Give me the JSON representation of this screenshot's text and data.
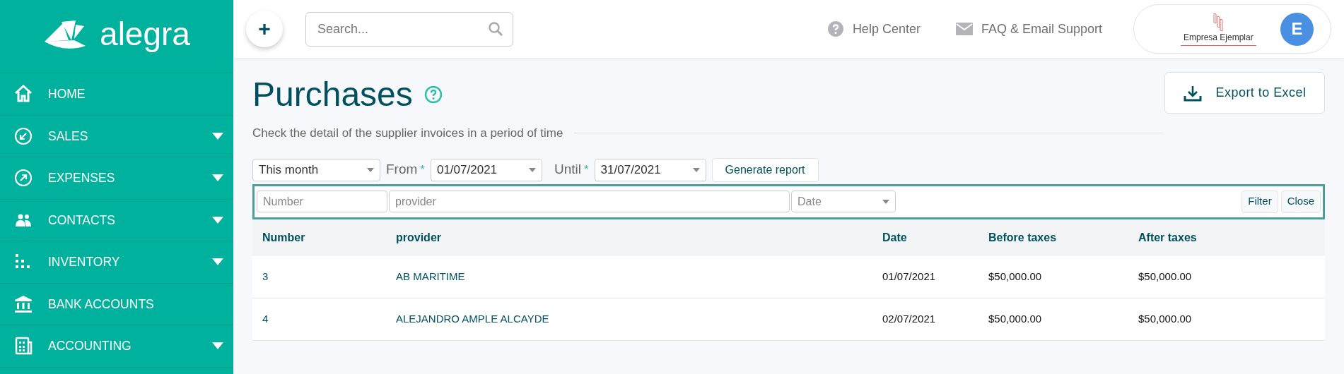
{
  "sidebar": {
    "logo": "alegra",
    "items": [
      {
        "label": "HOME",
        "kind": "home",
        "expandable": false
      },
      {
        "label": "SALES",
        "kind": "sales",
        "expandable": true
      },
      {
        "label": "EXPENSES",
        "kind": "expenses",
        "expandable": true
      },
      {
        "label": "CONTACTS",
        "kind": "contacts",
        "expandable": true
      },
      {
        "label": "INVENTORY",
        "kind": "inventory",
        "expandable": true
      },
      {
        "label": "BANK ACCOUNTS",
        "kind": "bank",
        "expandable": false
      },
      {
        "label": "ACCOUNTING",
        "kind": "accounting",
        "expandable": true
      }
    ]
  },
  "topbar": {
    "add_button": "+",
    "search": {
      "placeholder": "Search..."
    },
    "links": [
      {
        "label": "Help Center",
        "kind": "help"
      },
      {
        "label": "FAQ & Email Support",
        "kind": "mail"
      }
    ],
    "company": "Empresa Ejemplar",
    "avatar": "E"
  },
  "page": {
    "title": "Purchases",
    "subtitle": "Check the detail of the supplier invoices in a period of time",
    "export_button": "Export to Excel"
  },
  "report": {
    "period": "This month",
    "from_label": "From",
    "from": "01/07/2021",
    "until_label": "Until",
    "until": "31/07/2021",
    "required_mark": "*",
    "generate_button": "Generate report"
  },
  "filters": {
    "number": {
      "placeholder": "Number"
    },
    "provider": {
      "placeholder": "provider"
    },
    "date": {
      "placeholder": "Date"
    },
    "buttons": [
      "Filter",
      "Close"
    ]
  },
  "table": {
    "columns": [
      "Number",
      "provider",
      "Date",
      "Before taxes",
      "After taxes"
    ],
    "rows": [
      [
        "3",
        "AB MARITIME",
        "01/07/2021",
        "$50,000.00",
        "$50,000.00"
      ],
      [
        "4",
        "ALEJANDRO AMPLE ALCAYDE",
        "02/07/2021",
        "$50,000.00",
        "$50,000.00"
      ]
    ]
  }
}
